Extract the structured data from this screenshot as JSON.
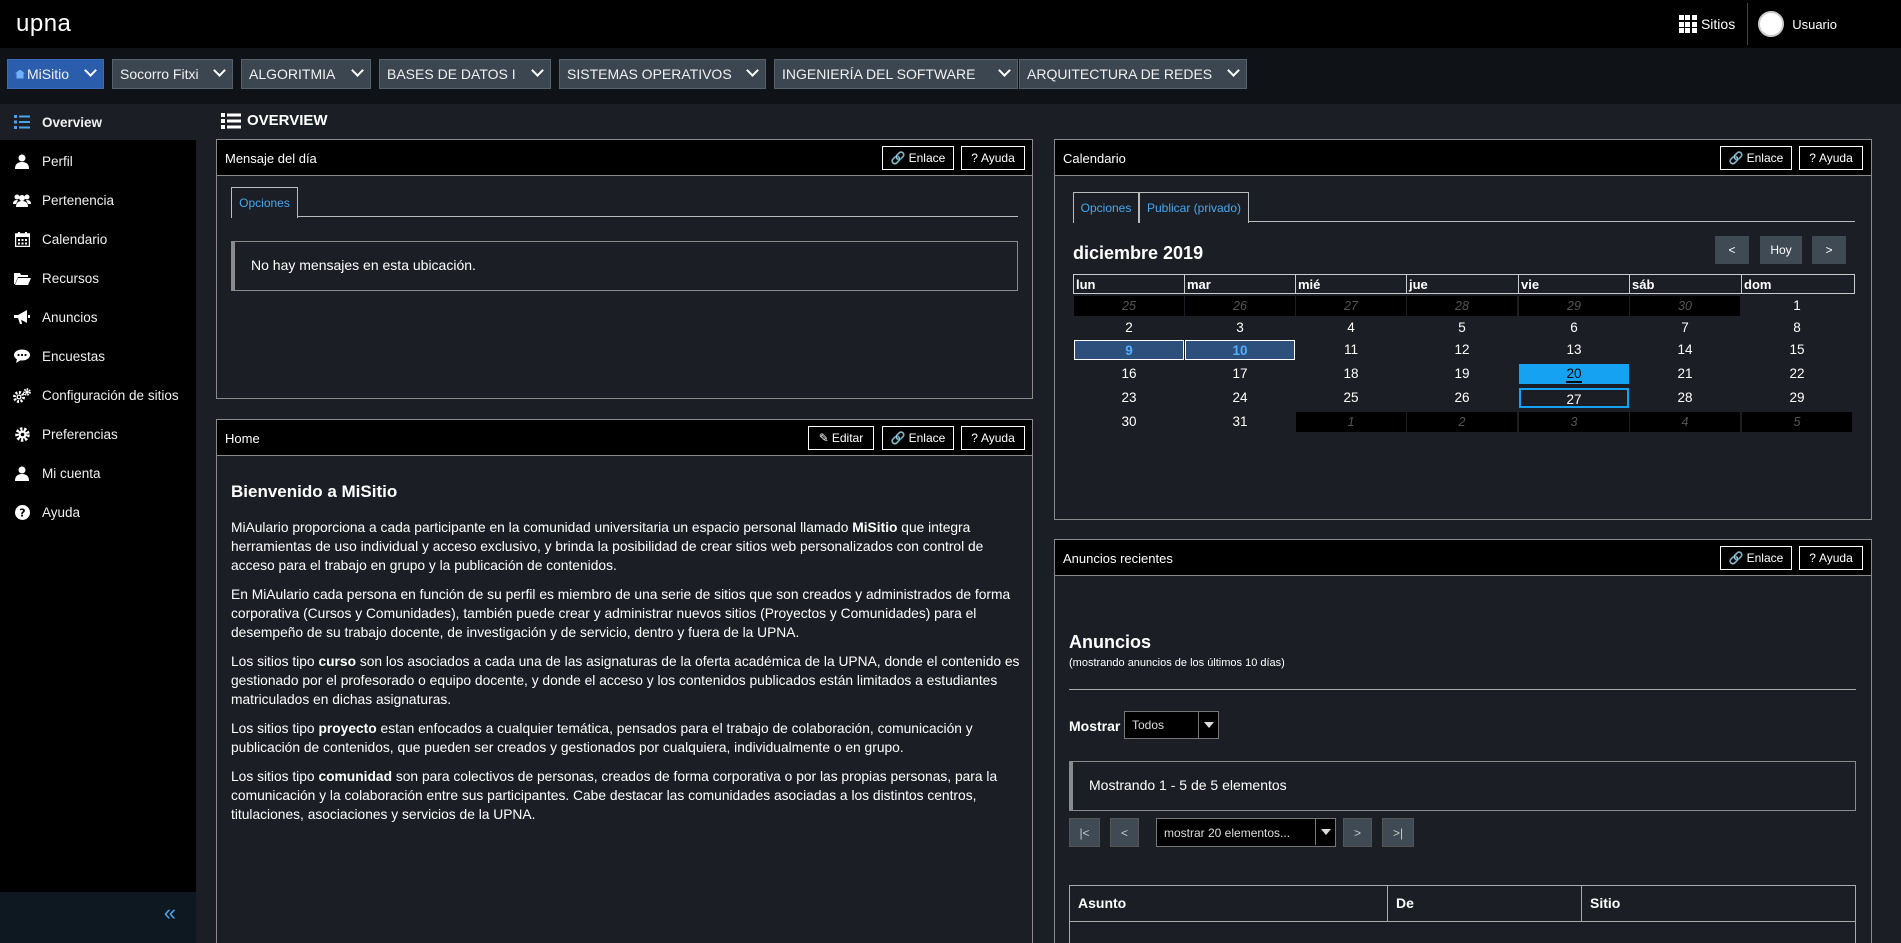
{
  "header": {
    "brand": "upna",
    "sites_label": "Sitios",
    "user_label": "Usuario"
  },
  "site_tabs": [
    {
      "label": "MiSitio"
    },
    {
      "label": "Socorro Fitxi"
    },
    {
      "label": "ALGORITMIA"
    },
    {
      "label": "BASES DE DATOS I"
    },
    {
      "label": "SISTEMAS OPERATIVOS"
    },
    {
      "label": "INGENIERÍA DEL SOFTWARE"
    },
    {
      "label": "ARQUITECTURA DE REDES"
    }
  ],
  "sidebar": {
    "items": [
      {
        "label": "Overview",
        "icon": "list-icon"
      },
      {
        "label": "Perfil",
        "icon": "user-icon"
      },
      {
        "label": "Pertenencia",
        "icon": "users-icon"
      },
      {
        "label": "Calendario",
        "icon": "calendar-icon"
      },
      {
        "label": "Recursos",
        "icon": "folder-icon"
      },
      {
        "label": "Anuncios",
        "icon": "megaphone-icon"
      },
      {
        "label": "Encuestas",
        "icon": "chat-icon"
      },
      {
        "label": "Configuración de sitios",
        "icon": "gears-icon"
      },
      {
        "label": "Preferencias",
        "icon": "gear-icon"
      },
      {
        "label": "Mi cuenta",
        "icon": "user-icon"
      },
      {
        "label": "Ayuda",
        "icon": "help-icon"
      }
    ],
    "collapse_glyph": "«"
  },
  "page": {
    "title": "OVERVIEW"
  },
  "buttons": {
    "link": "Enlace",
    "help": "Ayuda",
    "edit": "Editar"
  },
  "motd": {
    "title": "Mensaje del día",
    "tab_options": "Opciones",
    "empty": "No hay mensajes en esta ubicación."
  },
  "home": {
    "title": "Home",
    "heading": "Bienvenido a MiSitio",
    "p1_a": "MiAulario proporciona a cada participante en la comunidad universitaria un espacio personal llamado ",
    "p1_b": "MiSitio",
    "p1_c": " que integra herramientas de uso individual y acceso exclusivo, y brinda la posibilidad de crear sitios web personalizados con control de acceso para el trabajo en grupo y la publicación de contenidos.",
    "p2": "En MiAulario cada persona en función de su perfil es miembro de una serie de sitios que son creados y administrados de forma corporativa (Cursos y Comunidades), también puede crear y administrar nuevos sitios (Proyectos y Comunidades) para el desempeño de su trabajo docente, de investigación y de servicio, dentro y fuera de la UPNA.",
    "p3_a": "Los sitios tipo ",
    "p3_b": "curso",
    "p3_c": " son los asociados a cada una de las asignaturas de la oferta académica de la UPNA, donde el contenido es gestionado por el profesorado o equipo docente, y donde el acceso y los contenidos publicados están limitados a estudiantes matriculados en dichas asignaturas.",
    "p4_a": "Los sitios tipo ",
    "p4_b": "proyecto",
    "p4_c": " estan enfocados a cualquier temática, pensados para el trabajo de colaboración, comunicación y publicación de contenidos, que pueden ser creados y gestionados por cualquiera, individualmente o en grupo.",
    "p5_a": "Los sitios tipo ",
    "p5_b": "comunidad",
    "p5_c": " son para colectivos de personas, creados de forma corporativa o por las propias personas, para la comunicación y la colaboración entre sus participantes. Cabe destacar las comunidades asociadas a los distintos centros, titulaciones, asociaciones y servicios de la UPNA."
  },
  "calendar": {
    "title": "Calendario",
    "tab_options": "Opciones",
    "tab_publish": "Publicar (privado)",
    "month": "diciembre 2019",
    "nav_prev": "<",
    "nav_today": "Hoy",
    "nav_next": ">",
    "weekdays": [
      "lun",
      "mar",
      "mié",
      "jue",
      "vie",
      "sáb",
      "dom"
    ],
    "weeks": [
      [
        {
          "d": "25",
          "s": "other"
        },
        {
          "d": "26",
          "s": "other"
        },
        {
          "d": "27",
          "s": "other"
        },
        {
          "d": "28",
          "s": "other"
        },
        {
          "d": "29",
          "s": "other"
        },
        {
          "d": "30",
          "s": "other"
        },
        {
          "d": "1",
          "s": ""
        }
      ],
      [
        {
          "d": "2",
          "s": ""
        },
        {
          "d": "3",
          "s": ""
        },
        {
          "d": "4",
          "s": ""
        },
        {
          "d": "5",
          "s": ""
        },
        {
          "d": "6",
          "s": ""
        },
        {
          "d": "7",
          "s": ""
        },
        {
          "d": "8",
          "s": ""
        }
      ],
      [
        {
          "d": "9",
          "s": "event"
        },
        {
          "d": "10",
          "s": "event"
        },
        {
          "d": "11",
          "s": ""
        },
        {
          "d": "12",
          "s": ""
        },
        {
          "d": "13",
          "s": ""
        },
        {
          "d": "14",
          "s": ""
        },
        {
          "d": "15",
          "s": ""
        }
      ],
      [
        {
          "d": "16",
          "s": ""
        },
        {
          "d": "17",
          "s": ""
        },
        {
          "d": "18",
          "s": ""
        },
        {
          "d": "19",
          "s": ""
        },
        {
          "d": "20",
          "s": "today"
        },
        {
          "d": "21",
          "s": ""
        },
        {
          "d": "22",
          "s": ""
        }
      ],
      [
        {
          "d": "23",
          "s": ""
        },
        {
          "d": "24",
          "s": ""
        },
        {
          "d": "25",
          "s": ""
        },
        {
          "d": "26",
          "s": ""
        },
        {
          "d": "27",
          "s": "sel"
        },
        {
          "d": "28",
          "s": ""
        },
        {
          "d": "29",
          "s": ""
        }
      ],
      [
        {
          "d": "30",
          "s": ""
        },
        {
          "d": "31",
          "s": ""
        },
        {
          "d": "1",
          "s": "other"
        },
        {
          "d": "2",
          "s": "other"
        },
        {
          "d": "3",
          "s": "other"
        },
        {
          "d": "4",
          "s": "other"
        },
        {
          "d": "5",
          "s": "other"
        }
      ]
    ]
  },
  "announcements": {
    "title": "Anuncios recientes",
    "heading": "Anuncios",
    "subheading": "(mostrando anuncios de los últimos 10 días)",
    "show_label": "Mostrar",
    "show_value": "Todos",
    "showing": "Mostrando 1 - 5 de 5 elementos",
    "pager_first": "|<",
    "pager_prev": "<",
    "pager_size": "mostrar 20 elementos...",
    "pager_next": ">",
    "pager_last": ">|",
    "columns": [
      "Asunto",
      "De",
      "Sitio"
    ]
  },
  "colors": {
    "accent": "#15a2f2",
    "active_tab": "#2a5dab",
    "header": "#000000",
    "background": "#1b1f25"
  }
}
